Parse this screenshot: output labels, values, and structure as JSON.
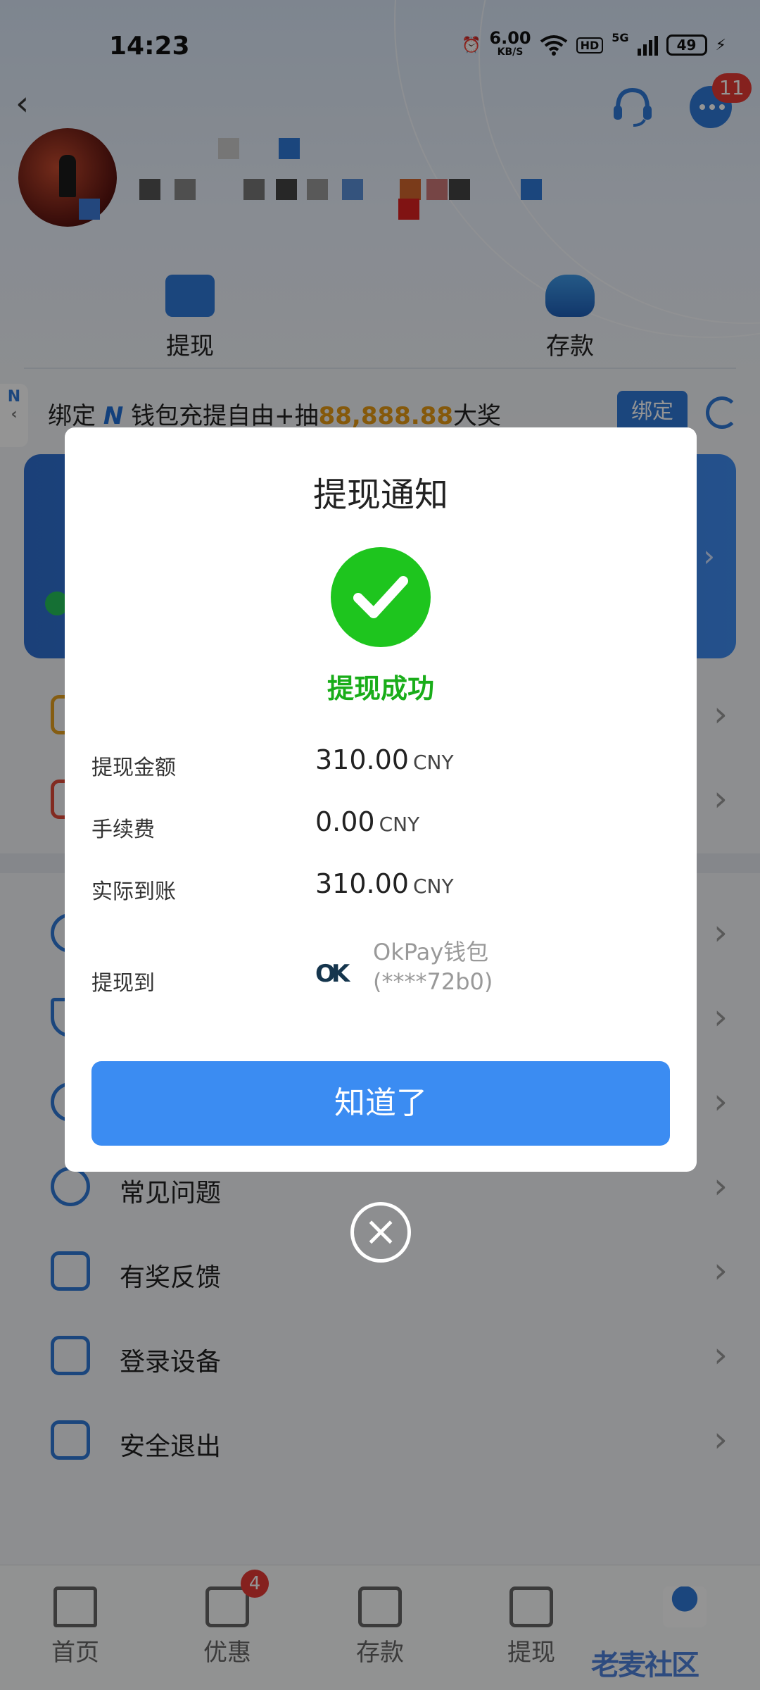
{
  "status_bar": {
    "time": "14:23",
    "net_speed": "6.00",
    "net_unit": "KB/S",
    "hd": "HD",
    "signal": "5G",
    "battery": "49"
  },
  "header": {
    "message_badge": "11"
  },
  "quick_actions": [
    {
      "label": "提现"
    },
    {
      "label": "存款"
    }
  ],
  "bind_banner": {
    "nb_side": "N",
    "text_prefix": "绑定",
    "logo": "N",
    "text_mid": "钱包充提自由+抽",
    "amount": "88,888.88",
    "text_suffix": "大奖",
    "button": "绑定"
  },
  "menu": [
    {
      "label": "常见问题"
    },
    {
      "label": "有奖反馈"
    },
    {
      "label": "登录设备"
    },
    {
      "label": "安全退出"
    }
  ],
  "tabs": [
    {
      "label": "首页"
    },
    {
      "label": "优惠",
      "badge": "4"
    },
    {
      "label": "存款"
    },
    {
      "label": "提现"
    },
    {
      "label": ""
    }
  ],
  "modal": {
    "title": "提现通知",
    "status": "提现成功",
    "rows": [
      {
        "key": "提现金额",
        "value": "310.00",
        "unit": "CNY"
      },
      {
        "key": "手续费",
        "value": "0.00",
        "unit": "CNY"
      },
      {
        "key": "实际到账",
        "value": "310.00",
        "unit": "CNY"
      }
    ],
    "dest_key": "提现到",
    "wallet_logo": "OK",
    "wallet_name": "OkPay钱包",
    "wallet_account": "(****72b0)",
    "confirm": "知道了"
  },
  "watermark": "老麦社区",
  "colors": {
    "accent": "#2f79d8",
    "success": "#1ec51e",
    "confirm_button": "#3b8cf2",
    "highlight": "#e59a14",
    "badge": "#e53935"
  }
}
